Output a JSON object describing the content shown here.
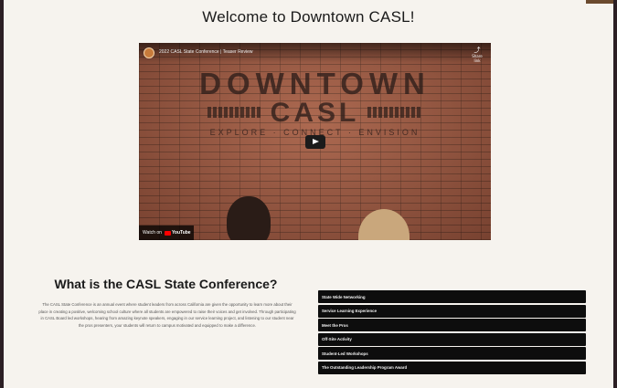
{
  "page": {
    "title": "Welcome to Downtown CASL!"
  },
  "video": {
    "title": "2022 CASL State Conference | Teaser Review",
    "share_icon": "share-icon",
    "share_label": "Share link",
    "brand_line1": "DOWNTOWN",
    "brand_line2": "CASL",
    "brand_line3": "EXPLORE · CONNECT · ENVISION",
    "watch_on": "Watch on",
    "platform": "YouTube"
  },
  "about": {
    "heading": "What is the CASL State Conference?",
    "body": "The CASL State Conference is an annual event where student leaders from across California are given the opportunity to learn more about their place in creating a positive, welcoming school culture where all students are empowered to raise their voices and get involved. Through participating in CASL Board led workshops, hearing from amazing keynote speakers, engaging in our service learning project, and listening to our student near the pros presenters, your students will return to campus motivated and equipped to make a difference."
  },
  "menu": {
    "items": [
      {
        "label": "State Wide Networking"
      },
      {
        "label": "Service Learning Experience"
      },
      {
        "label": "Meet the Pros"
      },
      {
        "label": "Off-Site Activity"
      },
      {
        "label": "Student-Led Workshops"
      },
      {
        "label": "The Outstanding Leadership Program Award"
      }
    ]
  },
  "colors": {
    "background": "#f6f3ee",
    "frame": "#2b1f24",
    "menu_bg": "#0d0d0d",
    "menu_text": "#f2f2f2"
  }
}
